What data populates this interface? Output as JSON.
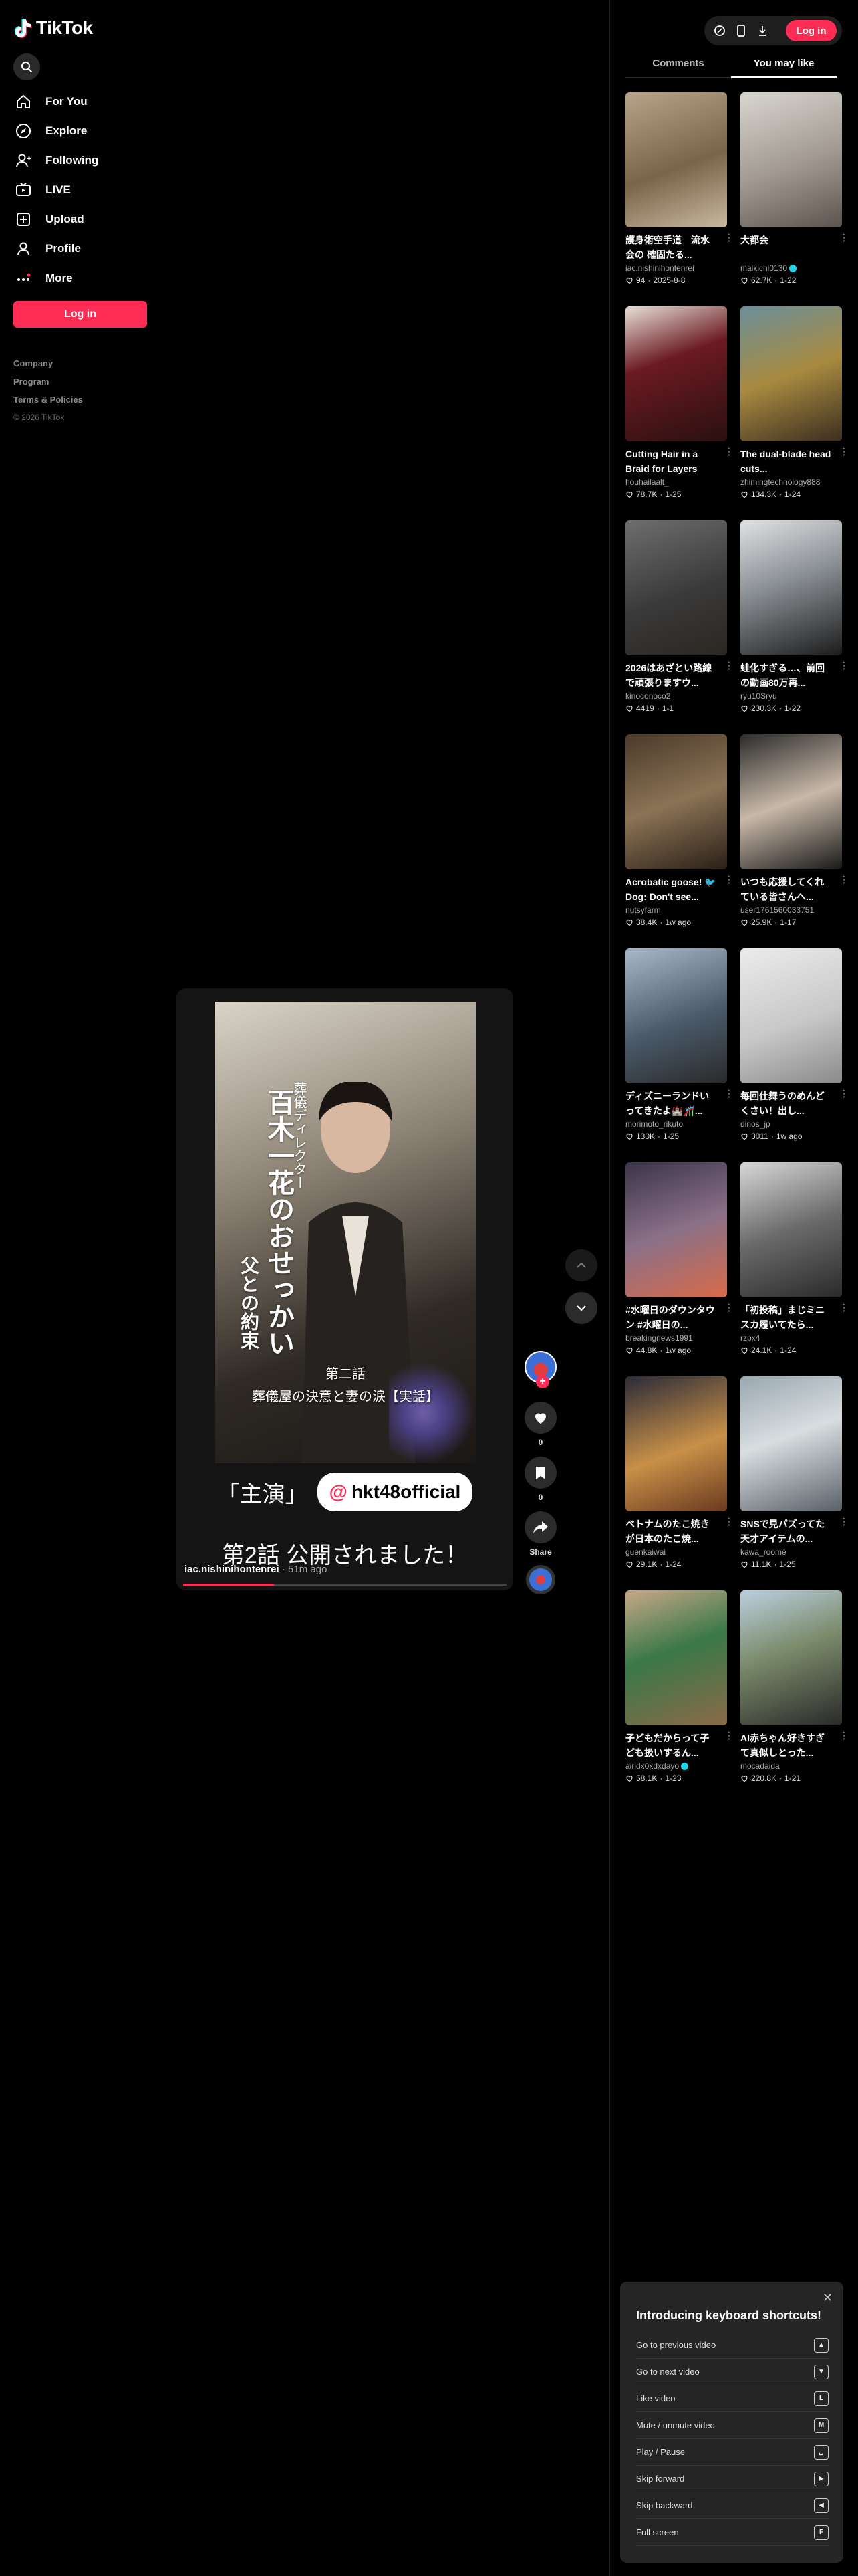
{
  "brand": {
    "name": "TikTok",
    "accent": "#fe2c55",
    "cyan": "#25f4ee"
  },
  "sidebar": {
    "nav": [
      {
        "label": "For You",
        "icon": "home-icon"
      },
      {
        "label": "Explore",
        "icon": "compass-icon"
      },
      {
        "label": "Following",
        "icon": "following-icon"
      },
      {
        "label": "LIVE",
        "icon": "live-icon"
      },
      {
        "label": "Upload",
        "icon": "upload-icon"
      },
      {
        "label": "Profile",
        "icon": "profile-icon"
      },
      {
        "label": "More",
        "icon": "more-icon"
      }
    ],
    "login_label": "Log in",
    "footer": {
      "company": "Company",
      "program": "Program",
      "terms": "Terms & Policies",
      "copyright": "© 2026 TikTok"
    }
  },
  "header": {
    "login_label": "Log in"
  },
  "tabs": {
    "comments": "Comments",
    "you_may_like": "You may like",
    "active": "you_may_like"
  },
  "video": {
    "poster_vertical_1": "葬儀ディレクター",
    "poster_vertical_2": "百木一花のおせっかい",
    "poster_vertical_3": "父との約束",
    "poster_episode": "第二話",
    "poster_episode_sub": "葬儀屋の決意と妻の涙【実話】",
    "caption_left": "「主演」",
    "caption_handle": "hkt48official",
    "caption_main": "第2話 公開されました！",
    "author": "iac.nishinihontenrei",
    "posted": "51m ago",
    "progress": 0.28
  },
  "actions": {
    "like_count": "0",
    "save_count": "0",
    "share_label": "Share"
  },
  "recommendations": [
    {
      "title": "護身術空手道　流水会の 確固たる...",
      "author": "iac.nishinihontenrei",
      "verified": false,
      "likes": "94",
      "date": "2025-8-8"
    },
    {
      "title": "大都会",
      "author": "maikichi0130",
      "verified": true,
      "likes": "62.7K",
      "date": "1-22"
    },
    {
      "title": "Cutting Hair in a Braid for Layers",
      "author": "houhailaalt_",
      "verified": false,
      "likes": "78.7K",
      "date": "1-25"
    },
    {
      "title": "The dual-blade head cuts...",
      "author": "zhimingtechnology888",
      "verified": false,
      "likes": "134.3K",
      "date": "1-24"
    },
    {
      "title": "2026はあざとい路線で頑張りますウ...",
      "author": "kinoconoco2",
      "verified": false,
      "likes": "4419",
      "date": "1-1"
    },
    {
      "title": "蛙化すぎる…、前回の動画80万再...",
      "author": "ryu10Sryu",
      "verified": false,
      "likes": "230.3K",
      "date": "1-22"
    },
    {
      "title": "Acrobatic goose! 🐦 Dog: Don't see...",
      "author": "nutsyfarm",
      "verified": false,
      "likes": "38.4K",
      "date": "1w ago"
    },
    {
      "title": "いつも応援してくれている皆さんへ...",
      "author": "user1761560033751",
      "verified": false,
      "likes": "25.9K",
      "date": "1-17"
    },
    {
      "title": "ディズニーランドいってきたよ🏰🎢...",
      "author": "morimoto_rikuto",
      "verified": false,
      "likes": "130K",
      "date": "1-25"
    },
    {
      "title": "毎回仕舞うのめんどくさい！出し...",
      "author": "dinos_jp",
      "verified": false,
      "likes": "3011",
      "date": "1w ago"
    },
    {
      "title": "#水曜日のダウンタウン #水曜日の...",
      "author": "breakingnews1991",
      "verified": false,
      "likes": "44.8K",
      "date": "1w ago"
    },
    {
      "title": "「初投稿」まじミニスカ履いてたら...",
      "author": "rzpx4",
      "verified": false,
      "likes": "24.1K",
      "date": "1-24"
    },
    {
      "title": "ベトナムのたこ焼きが日本のたこ焼...",
      "author": "guenkaiwai",
      "verified": false,
      "likes": "29.1K",
      "date": "1-24"
    },
    {
      "title": "SNSで見パズってた天才アイテムの...",
      "author": "kawa_roomé",
      "verified": false,
      "likes": "11.1K",
      "date": "1-25"
    },
    {
      "title": "子どもだからって子ども扱いするん...",
      "author": "airidx0xdxdayo",
      "verified": true,
      "likes": "58.1K",
      "date": "1-23"
    },
    {
      "title": "AI赤ちゃん好きすぎて真似しとった...",
      "author": "mocadaida",
      "verified": false,
      "likes": "220.8K",
      "date": "1-21"
    }
  ],
  "shortcuts": {
    "title": "Introducing keyboard shortcuts!",
    "items": [
      {
        "label": "Go to previous video",
        "key": "▲"
      },
      {
        "label": "Go to next video",
        "key": "▼"
      },
      {
        "label": "Like video",
        "key": "L"
      },
      {
        "label": "Mute / unmute video",
        "key": "M"
      },
      {
        "label": "Play / Pause",
        "key": "␣"
      },
      {
        "label": "Skip forward",
        "key": "▶"
      },
      {
        "label": "Skip backward",
        "key": "◀"
      },
      {
        "label": "Full screen",
        "key": "F"
      }
    ]
  }
}
